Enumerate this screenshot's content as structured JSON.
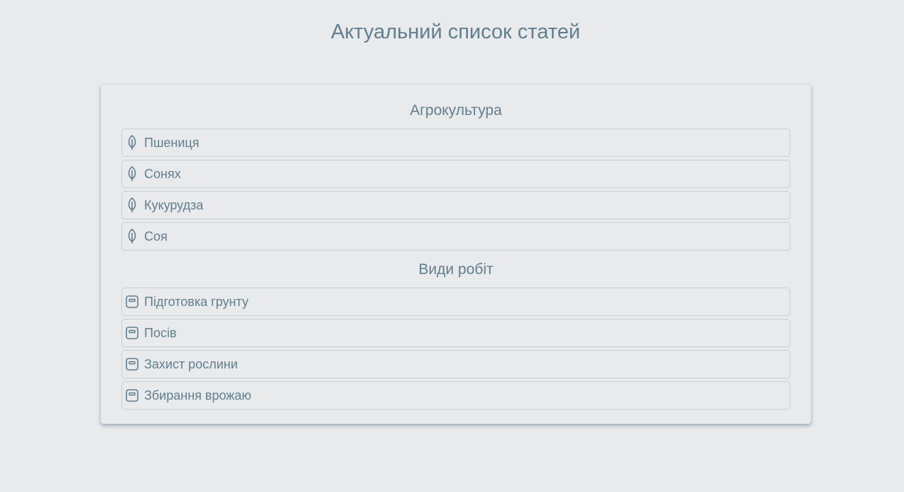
{
  "page": {
    "title": "Актуальний список статей"
  },
  "sections": [
    {
      "title": "Агрокультура",
      "icon": "leaf-icon",
      "items": [
        {
          "label": "Пшениця"
        },
        {
          "label": "Сонях"
        },
        {
          "label": "Кукурудза"
        },
        {
          "label": "Соя"
        }
      ]
    },
    {
      "title": "Види робіт",
      "icon": "work-card-icon",
      "items": [
        {
          "label": "Підготовка грунту"
        },
        {
          "label": "Посів"
        },
        {
          "label": "Захист рослини"
        },
        {
          "label": "Збирання врожаю"
        }
      ]
    }
  ],
  "colors": {
    "background": "#e9eaec",
    "text": "#5f7f8f",
    "border": "#cbcdd0"
  }
}
